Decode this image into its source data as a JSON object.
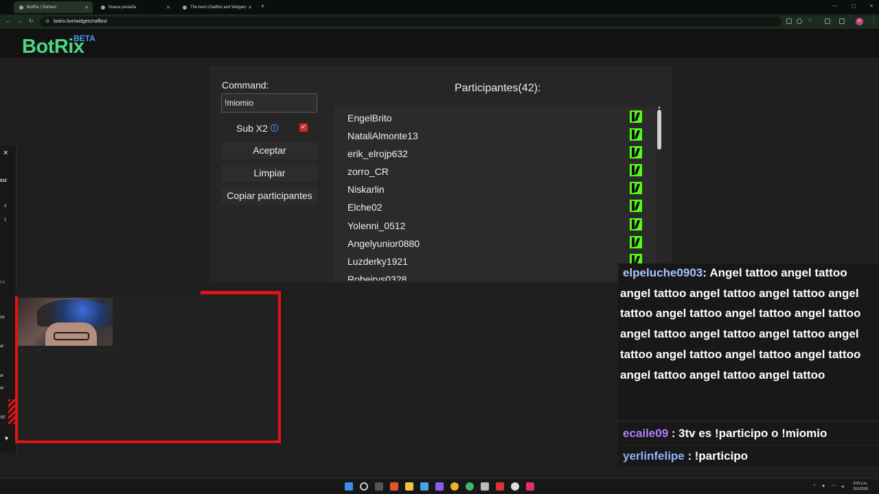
{
  "browser": {
    "tabs": [
      {
        "label": "BotRix | Sorteos",
        "active": true
      },
      {
        "label": "Nueva pestaña",
        "active": false
      },
      {
        "label": "The best ChatBot and Widgets",
        "active": false
      }
    ],
    "url": "botrix.live/widgets/raffles/",
    "profile_initial": "A"
  },
  "site": {
    "logo": "BotRix",
    "beta": "BETA"
  },
  "raffle": {
    "command_label": "Command:",
    "command_value": "!miomio",
    "sub_label": "Sub X2",
    "sub_checked": true,
    "accept_button": "Aceptar",
    "clear_button": "Limpiar",
    "copy_button": "Copiar participantes",
    "participants_title": "Participantes(42):",
    "participants": [
      "EngelBrito",
      "NataliAlmonte13",
      "erik_elrojp632",
      "zorro_CR",
      "Niskarlin",
      "Elche02",
      "Yolenni_0512",
      "Angelyunior0880",
      "Luzderky1921",
      "Robeirys0328"
    ]
  },
  "overlay_left": {
    "texts": [
      "632",
      "3",
      "1",
      "los",
      "rtir",
      "ar",
      "ar",
      "ar",
      "VE"
    ]
  },
  "chat": {
    "messages": [
      {
        "user": "elpeluche0903",
        "user_color": "#a8c4ff",
        "text": "Angel tattoo angel tattoo angel tattoo angel tattoo angel tattoo angel tattoo angel tattoo angel tattoo angel tattoo angel tattoo angel tattoo angel tattoo angel tattoo angel tattoo angel tattoo angel tattoo angel tattoo angel tattoo angel tattoo"
      },
      {
        "user": "ecaile09",
        "user_color": "#b57cff",
        "text": "3tv es !participo o !miomio"
      },
      {
        "user": "yerlinfelipe",
        "user_color": "#8fb4ff",
        "text": "!participo"
      }
    ]
  },
  "taskbar": {
    "time": "8:29 p.m.",
    "date": "19/1/2026"
  }
}
